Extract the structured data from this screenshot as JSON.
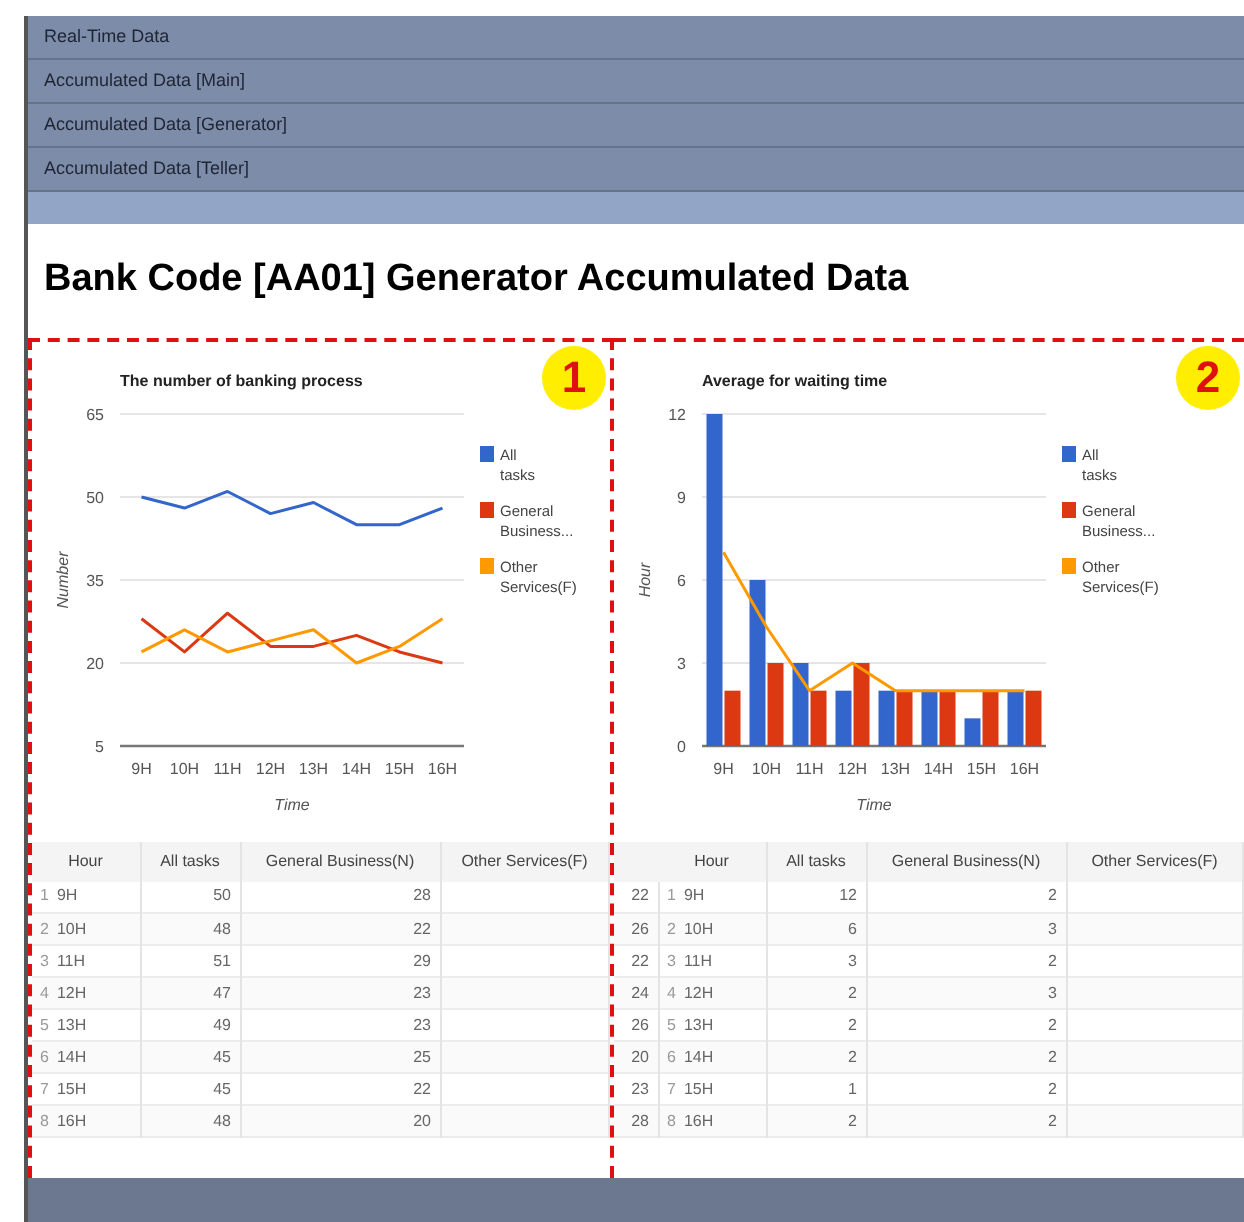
{
  "nav": {
    "items": [
      "Real-Time Data",
      "Accumulated Data [Main]",
      "Accumulated Data [Generator]",
      "Accumulated Data [Teller]"
    ]
  },
  "title": "Bank Code [AA01] Generator Accumulated Data",
  "panels": [
    {
      "badge": "1",
      "chart_data": {
        "type": "line",
        "grid": true,
        "legend": true,
        "title": "The number of banking process",
        "xlabel": "Time",
        "ylabel": "Number",
        "categories": [
          "9H",
          "10H",
          "11H",
          "12H",
          "13H",
          "14H",
          "15H",
          "16H"
        ],
        "ylim": [
          5,
          65
        ],
        "yticks": [
          5,
          20,
          35,
          50,
          65
        ],
        "series": [
          {
            "name": "All tasks",
            "color": "#3366cc",
            "values": [
              50,
              48,
              51,
              47,
              49,
              45,
              45,
              48
            ]
          },
          {
            "name": "General Business...",
            "color": "#dc3912",
            "values": [
              28,
              22,
              29,
              23,
              23,
              25,
              22,
              20
            ]
          },
          {
            "name": "Other Services(F)",
            "color": "#ff9900",
            "values": [
              22,
              26,
              22,
              24,
              26,
              20,
              23,
              28
            ]
          }
        ]
      },
      "table": {
        "columns": [
          "Hour",
          "All tasks",
          "General Business(N)",
          "Other Services(F)"
        ],
        "rows": [
          {
            "index": "1",
            "hour": "9H",
            "all": "50",
            "general": "28"
          },
          {
            "index": "2",
            "hour": "10H",
            "all": "48",
            "general": "22"
          },
          {
            "index": "3",
            "hour": "11H",
            "all": "51",
            "general": "29"
          },
          {
            "index": "4",
            "hour": "12H",
            "all": "47",
            "general": "23"
          },
          {
            "index": "5",
            "hour": "13H",
            "all": "49",
            "general": "23"
          },
          {
            "index": "6",
            "hour": "14H",
            "all": "45",
            "general": "25"
          },
          {
            "index": "7",
            "hour": "15H",
            "all": "45",
            "general": "22"
          },
          {
            "index": "8",
            "hour": "16H",
            "all": "48",
            "general": "20"
          }
        ]
      }
    },
    {
      "badge": "2",
      "chart_data": {
        "type": "bar",
        "grid": true,
        "legend": true,
        "title": "Average for waiting time",
        "xlabel": "Time",
        "ylabel": "Hour",
        "categories": [
          "9H",
          "10H",
          "11H",
          "12H",
          "13H",
          "14H",
          "15H",
          "16H"
        ],
        "ylim": [
          0,
          12
        ],
        "yticks": [
          0,
          3,
          6,
          9,
          12
        ],
        "series": [
          {
            "name": "All tasks",
            "color": "#3366cc",
            "type": "bar",
            "values": [
              12,
              6,
              3,
              2,
              2,
              2,
              1,
              2
            ]
          },
          {
            "name": "General Business...",
            "color": "#dc3912",
            "type": "bar",
            "values": [
              2,
              3,
              2,
              3,
              2,
              2,
              2,
              2
            ]
          },
          {
            "name": "Other Services(F)",
            "color": "#ff9900",
            "type": "line",
            "values": [
              7,
              4.3,
              2,
              3,
              2,
              2,
              2,
              2
            ]
          }
        ]
      },
      "table": {
        "columns": [
          "Hour",
          "All tasks",
          "General Business(N)",
          "Other Services(F)"
        ],
        "rows": [
          {
            "column_1": "22",
            "index": "1",
            "hour": "9H",
            "all": "12",
            "general": "2"
          },
          {
            "column_1": "26",
            "index": "2",
            "hour": "10H",
            "all": "6",
            "general": "3"
          },
          {
            "column_1": "22",
            "index": "3",
            "hour": "11H",
            "all": "3",
            "general": "2"
          },
          {
            "column_1": "24",
            "index": "4",
            "hour": "12H",
            "all": "2",
            "general": "3"
          },
          {
            "column_1": "26",
            "index": "5",
            "hour": "13H",
            "all": "2",
            "general": "2"
          },
          {
            "column_1": "20",
            "index": "6",
            "hour": "14H",
            "all": "2",
            "general": "2"
          },
          {
            "column_1": "23",
            "index": "7",
            "hour": "15H",
            "all": "1",
            "general": "2"
          },
          {
            "column_1": "28",
            "index": "8",
            "hour": "16H",
            "all": "2",
            "general": "2"
          }
        ]
      }
    }
  ]
}
